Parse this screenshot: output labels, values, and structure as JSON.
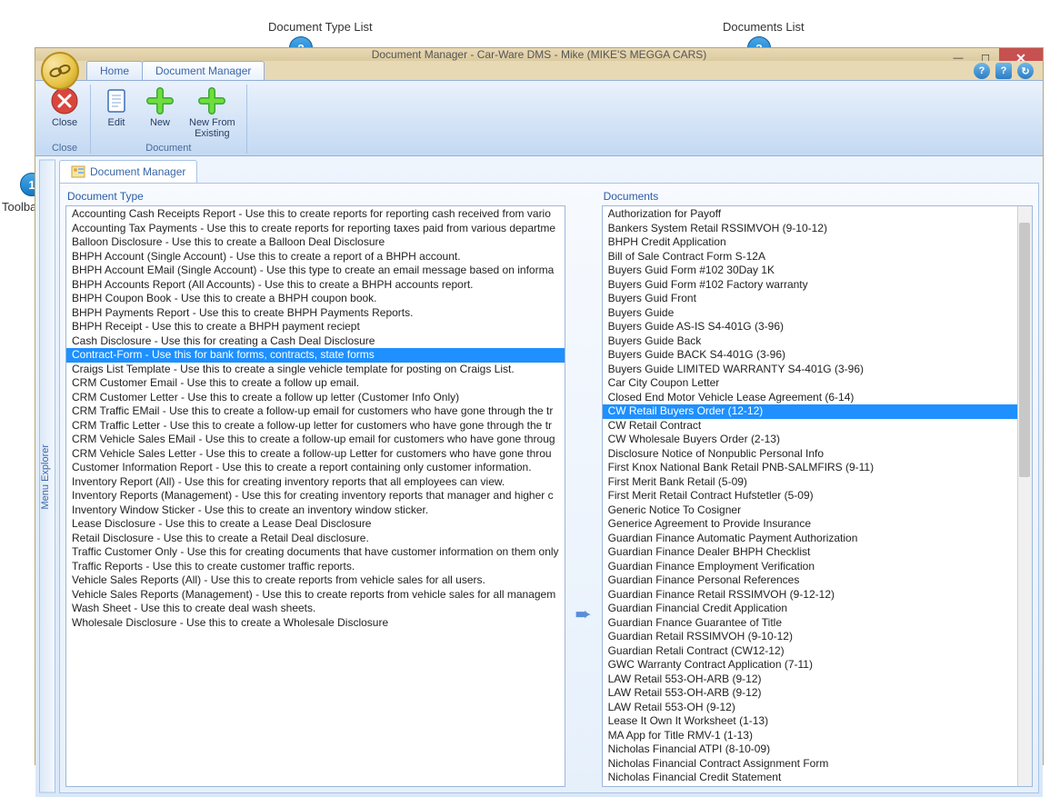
{
  "callouts": {
    "c1": {
      "badge": "1",
      "label": "Toolbar"
    },
    "c2": {
      "badge": "2",
      "label": "Document Type List"
    },
    "c3": {
      "badge": "3",
      "label": "Documents List"
    }
  },
  "titlebar": {
    "text": "Document Manager - Car-Ware DMS - Mike (MIKE'S MEGGA CARS)"
  },
  "tabs": {
    "home": "Home",
    "docmgr": "Document Manager"
  },
  "ribbon": {
    "close_group": "Close",
    "doc_group": "Document",
    "close": "Close",
    "edit": "Edit",
    "new": "New",
    "new_from": "New From\nExisting"
  },
  "side_explorer": "Menu Explorer",
  "doc_tab": "Document Manager",
  "panel_left_title": "Document Type",
  "panel_right_title": "Documents",
  "doc_types_selected_index": 10,
  "doc_types": [
    "Accounting Cash Receipts Report - Use this to create reports for reporting cash received from vario",
    "Accounting Tax Payments - Use this to create reports for reporting taxes paid from various departme",
    "Balloon Disclosure - Use this to create a Balloon Deal Disclosure",
    "BHPH Account (Single Account) - Use this to create a report of a BHPH account.",
    "BHPH Account EMail (Single Account) - Use this type to create an email message based on informa",
    "BHPH Accounts Report (All Accounts) - Use this to create a BHPH accounts report.",
    "BHPH Coupon Book - Use this to create a BHPH coupon book.",
    "BHPH Payments Report - Use this to create BHPH Payments Reports.",
    "BHPH Receipt - Use this to create a BHPH payment reciept",
    "Cash Disclosure - Use this for creating a Cash Deal Disclosure",
    "Contract-Form - Use this for bank forms, contracts, state forms",
    "Craigs List Template - Use this to create a single vehicle template for posting on Craigs List.",
    "CRM Customer Email - Use this to create a follow up email.",
    "CRM Customer Letter - Use this to create a follow up letter (Customer Info Only)",
    "CRM Traffic EMail - Use this to create a follow-up email for customers who have gone through the tr",
    "CRM Traffic Letter - Use this to create a follow-up letter for customers who have gone through the tr",
    "CRM Vehicle Sales EMail - Use this to create a follow-up email for customers who have gone throug",
    "CRM Vehicle Sales Letter - Use this to create a follow-up Letter for customers who have gone throu",
    "Customer Information Report - Use this to create a report containing only customer information.",
    "Inventory Report (All) - Use this for creating inventory reports that all employees can view.",
    "Inventory Reports (Management) - Use this for creating inventory reports that manager and higher c",
    "Inventory Window Sticker - Use this to create an inventory window sticker.",
    "Lease Disclosure - Use this to create a Lease Deal Disclosure",
    "Retail Disclosure - Use this to create a Retail Deal disclosure.",
    "Traffic Customer Only - Use this for creating documents that have customer information on them only",
    "Traffic Reports - Use this to create customer traffic reports.",
    "Vehicle Sales Reports (All) - Use this to create reports from vehicle sales for all users.",
    "Vehicle Sales Reports (Management) - Use this to create reports from vehicle sales for all managem",
    "Wash Sheet - Use this to create deal wash sheets.",
    "Wholesale Disclosure - Use this to create a Wholesale Disclosure"
  ],
  "documents_selected_index": 14,
  "documents": [
    "Authorization for Payoff",
    "Bankers System Retail RSSIMVOH (9-10-12)",
    "BHPH Credit Application",
    "Bill of Sale Contract Form S-12A",
    "Buyers Guid Form #102 30Day 1K",
    "Buyers Guid Form #102 Factory warranty",
    "Buyers Guid Front",
    "Buyers Guide",
    "Buyers Guide AS-IS S4-401G (3-96)",
    "Buyers Guide Back",
    "Buyers Guide BACK S4-401G (3-96)",
    "Buyers Guide LIMITED WARRANTY S4-401G (3-96)",
    "Car City Coupon Letter",
    "Closed End Motor Vehicle Lease Agreement (6-14)",
    "CW Retail Buyers Order (12-12)",
    "CW Retail Contract",
    "CW Wholesale Buyers Order (2-13)",
    "Disclosure Notice of Nonpublic Personal Info",
    "First Knox National Bank Retail PNB-SALMFIRS (9-11)",
    "First Merit Bank Retail (5-09)",
    "First Merit Retail Contract Hufstetler (5-09)",
    "Generic Notice To Cosigner",
    "Generice Agreement to Provide Insurance",
    "Guardian Finance Automatic Payment Authorization",
    "Guardian Finance Dealer BHPH Checklist",
    "Guardian Finance Employment Verification",
    "Guardian Finance Personal References",
    "Guardian Finance Retail RSSIMVOH (9-12-12)",
    "Guardian Financial Credit Application",
    "Guardian Fnance Guarantee of Title",
    "Guardian Retail RSSIMVOH (9-10-12)",
    "Guardian Retali Contract (CW12-12)",
    "GWC Warranty Contract Application (7-11)",
    "LAW Retail 553-OH-ARB (9-12)",
    "LAW Retail 553-OH-ARB (9-12)",
    "LAW Retail 553-OH (9-12)",
    "Lease It Own It Worksheet (1-13)",
    "MA App for Title RMV-1 (1-13)",
    "Nicholas Financial ATPI (8-10-09)",
    "Nicholas Financial Contract Assignment Form",
    "Nicholas Financial Credit Statement"
  ]
}
